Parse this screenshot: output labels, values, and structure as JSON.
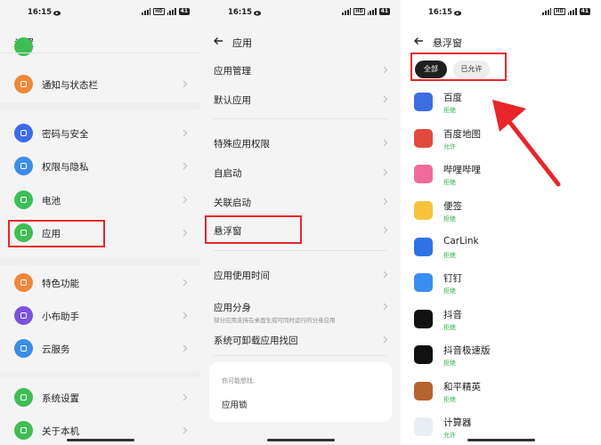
{
  "status_bar": {
    "time": "16:15",
    "battery": "41",
    "network_badge": "HD"
  },
  "colors": {
    "accent_green": "#35b04a",
    "highlight_red": "#e8262a",
    "pill_dark": "#1f1f1f"
  },
  "panel1": {
    "title": "设置",
    "items": [
      {
        "label": "通知与状态栏",
        "icon": "bell-icon",
        "color": "#f0873a"
      },
      {
        "label": "密码与安全",
        "icon": "shield-icon",
        "color": "#3c6de8"
      },
      {
        "label": "权限与隐私",
        "icon": "eye-icon",
        "color": "#3c8de8"
      },
      {
        "label": "电池",
        "icon": "battery-icon",
        "color": "#3fbd55"
      },
      {
        "label": "应用",
        "icon": "apps-grid-icon",
        "color": "#3fbd55"
      },
      {
        "label": "特色功能",
        "icon": "star-icon",
        "color": "#f0873a"
      },
      {
        "label": "小布助手",
        "icon": "assistant-icon",
        "color": "#7a52e0"
      },
      {
        "label": "云服务",
        "icon": "cloud-icon",
        "color": "#3c8de8"
      },
      {
        "label": "系统设置",
        "icon": "system-settings-icon",
        "color": "#3fbd55"
      },
      {
        "label": "关于本机",
        "icon": "phone-info-icon",
        "color": "#3fbd55"
      }
    ]
  },
  "panel2": {
    "title": "应用",
    "items": [
      {
        "label": "应用管理"
      },
      {
        "label": "默认应用"
      },
      {
        "label": "特殊应用权限"
      },
      {
        "label": "自启动"
      },
      {
        "label": "关联启动"
      },
      {
        "label": "悬浮窗"
      },
      {
        "label": "应用使用时间"
      },
      {
        "label": "应用分身",
        "sub": "部分应用支持在桌面生成可同时运行的分身应用"
      },
      {
        "label": "系统可卸载应用找回"
      }
    ],
    "suggest": {
      "heading": "你可能想找:",
      "item": "应用锁"
    }
  },
  "panel3": {
    "title": "悬浮窗",
    "filters": {
      "all": "全部",
      "allowed": "已允许"
    },
    "apps": [
      {
        "name": "百度",
        "status": "拒绝",
        "icon": "baidu-icon",
        "color": "#3b6fe0"
      },
      {
        "name": "百度地图",
        "status": "允许",
        "icon": "baidu-map-icon",
        "color": "#e24a3b"
      },
      {
        "name": "哔哩哔哩",
        "status": "拒绝",
        "icon": "bilibili-icon",
        "color": "#f06b9a"
      },
      {
        "name": "便签",
        "status": "拒绝",
        "icon": "notes-icon",
        "color": "#f5c43a"
      },
      {
        "name": "CarLink",
        "status": "拒绝",
        "icon": "carlink-icon",
        "color": "#2e73e6"
      },
      {
        "name": "钉钉",
        "status": "拒绝",
        "icon": "dingtalk-icon",
        "color": "#3a8ef0"
      },
      {
        "name": "抖音",
        "status": "拒绝",
        "icon": "douyin-icon",
        "color": "#111111"
      },
      {
        "name": "抖音极速版",
        "status": "拒绝",
        "icon": "douyin-lite-icon",
        "color": "#111111"
      },
      {
        "name": "和平精英",
        "status": "拒绝",
        "icon": "peace-elite-icon",
        "color": "#b8642e"
      },
      {
        "name": "计算器",
        "status": "允许",
        "icon": "calculator-icon",
        "color": "#e9eef5"
      }
    ]
  }
}
